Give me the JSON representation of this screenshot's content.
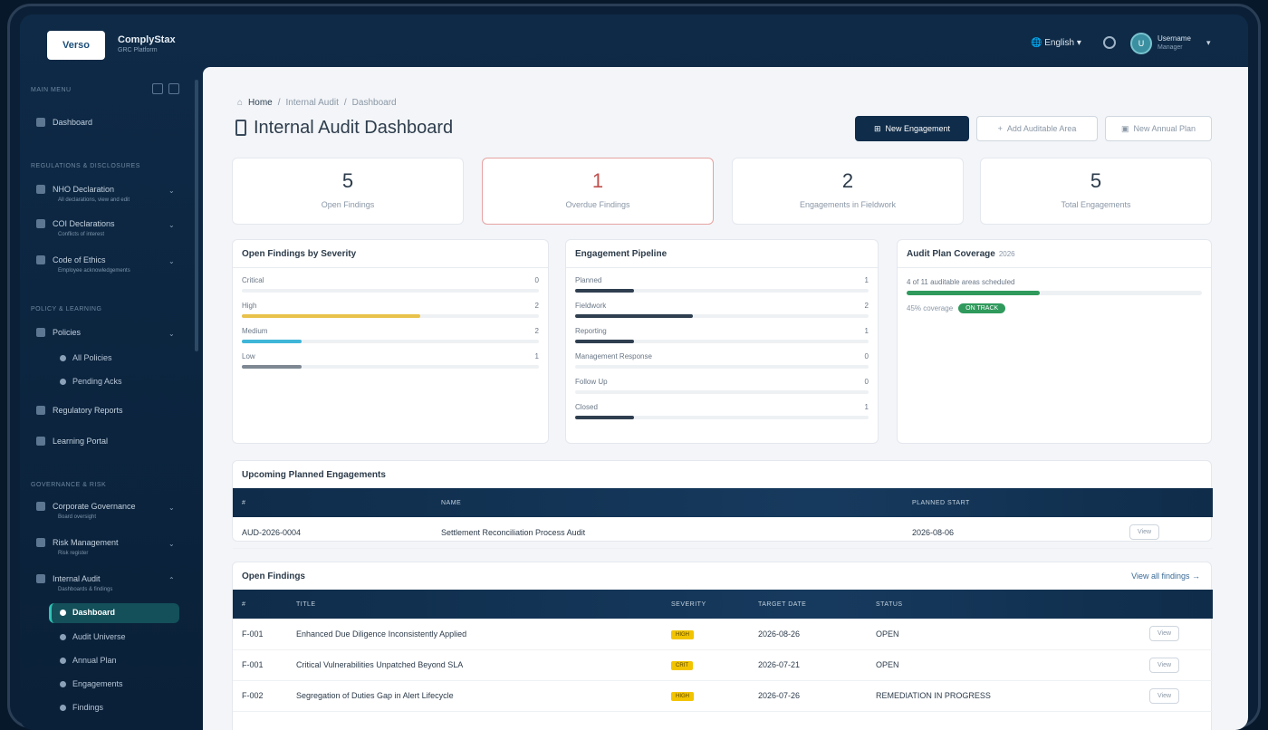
{
  "app": {
    "logo_text": "Verso",
    "name": "ComplyStax",
    "tagline": "GRC Platform",
    "language": "English",
    "user_initials": "U",
    "user_name": "Username",
    "user_role": "Manager"
  },
  "sidebar": {
    "section_main": "MAIN MENU",
    "dashboard": "Dashboard",
    "section_regs": "REGULATIONS & DISCLOSURES",
    "item_1": "NHO Declaration",
    "item_1_sub": "All declarations, view and edit",
    "item_2": "COI Declarations",
    "item_2_sub": "Conflicts of interest",
    "item_3": "Code of Ethics",
    "item_3_sub": "Employee acknowledgements",
    "section_policy": "POLICY & LEARNING",
    "policies": "Policies",
    "all_policies": "All Policies",
    "pending_acks": "Pending Acks",
    "regulatory_reports": "Regulatory Reports",
    "learning_portal": "Learning Portal",
    "section_gov": "GOVERNANCE & RISK",
    "gov_item": "Corporate Governance",
    "gov_item_sub": "Board oversight",
    "risk_item": "Risk Management",
    "risk_item_sub": "Risk register",
    "ia_item": "Internal Audit",
    "ia_item_sub": "Dashboards & findings",
    "ia_dashboard": "Dashboard",
    "ia_universe": "Audit Universe",
    "ia_plan": "Annual Plan",
    "ia_engagements": "Engagements",
    "ia_findings": "Findings"
  },
  "breadcrumb": {
    "home": "Home",
    "sep": "/",
    "level1": "Internal Audit",
    "level2": "Dashboard"
  },
  "page": {
    "title": "Internal Audit Dashboard",
    "btn_new_engagement": "New Engagement",
    "btn_add_area": "Add Auditable Area",
    "btn_new_plan": "New Annual Plan"
  },
  "stats": [
    {
      "value": "5",
      "label": "Open Findings"
    },
    {
      "value": "1",
      "label": "Overdue Findings"
    },
    {
      "value": "2",
      "label": "Engagements in Fieldwork"
    },
    {
      "value": "5",
      "label": "Total Engagements"
    }
  ],
  "severity_panel": {
    "title": "Open Findings by Severity",
    "rows": [
      {
        "label": "Critical",
        "value": "0",
        "fraction": 0.0,
        "color": "#9aa4ad"
      },
      {
        "label": "High",
        "value": "2",
        "fraction": 0.6,
        "color": "#e8c24a"
      },
      {
        "label": "Medium",
        "value": "2",
        "fraction": 0.2,
        "color": "#3fb6d8"
      },
      {
        "label": "Low",
        "value": "1",
        "fraction": 0.2,
        "color": "#7d8893"
      }
    ]
  },
  "pipeline_panel": {
    "title": "Engagement Pipeline",
    "rows": [
      {
        "label": "Planned",
        "value": "1",
        "fraction": 0.2,
        "color": "#2f3f50"
      },
      {
        "label": "Fieldwork",
        "value": "2",
        "fraction": 0.4,
        "color": "#2f3f50"
      },
      {
        "label": "Reporting",
        "value": "1",
        "fraction": 0.2,
        "color": "#2f3f50"
      },
      {
        "label": "Management Response",
        "value": "0",
        "fraction": 0.0,
        "color": "#2f3f50"
      },
      {
        "label": "Follow Up",
        "value": "0",
        "fraction": 0.0,
        "color": "#2f3f50"
      },
      {
        "label": "Closed",
        "value": "1",
        "fraction": 0.2,
        "color": "#2f3f50"
      }
    ]
  },
  "coverage_panel": {
    "title": "Audit Plan Coverage",
    "year": "2026",
    "text": "4 of 11 auditable areas scheduled",
    "fraction": 0.45,
    "pct_label": "45% coverage",
    "badge": "ON TRACK",
    "color": "#2f9a5c"
  },
  "upcoming": {
    "title": "Upcoming Planned Engagements",
    "headers": [
      "#",
      "NAME",
      "PLANNED START",
      ""
    ],
    "rows": [
      {
        "id": "AUD-2026-0004",
        "name": "Settlement Reconciliation Process Audit",
        "start": "2026-08-06",
        "action": "View"
      }
    ]
  },
  "findings": {
    "title": "Open Findings",
    "view_all": "View all findings →",
    "headers": [
      "#",
      "TITLE",
      "SEVERITY",
      "TARGET DATE",
      "STATUS",
      ""
    ],
    "rows": [
      {
        "id": "F-001",
        "title": "Enhanced Due Diligence Inconsistently Applied",
        "severity": "HIGH",
        "target": "2026-08-26",
        "status": "OPEN",
        "action": "View"
      },
      {
        "id": "F-001",
        "title": "Critical Vulnerabilities Unpatched Beyond SLA",
        "severity": "CRIT",
        "target": "2026-07-21",
        "status": "OPEN",
        "action": "View"
      },
      {
        "id": "F-002",
        "title": "Segregation of Duties Gap in Alert Lifecycle",
        "severity": "HIGH",
        "target": "2026-07-26",
        "status": "REMEDIATION IN PROGRESS",
        "action": "View"
      }
    ]
  }
}
